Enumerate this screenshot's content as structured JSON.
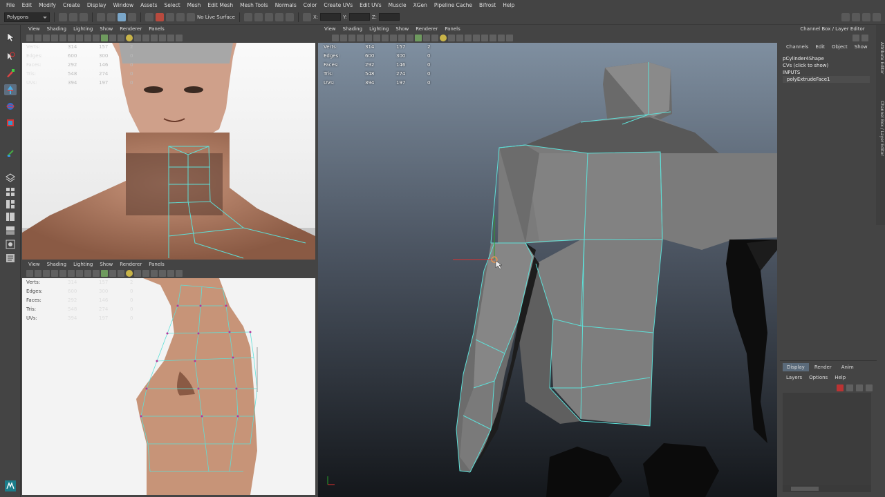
{
  "menubar": {
    "items": [
      "File",
      "Edit",
      "Modify",
      "Create",
      "Display",
      "Window",
      "Assets",
      "Select",
      "Mesh",
      "Edit Mesh",
      "Mesh Tools",
      "Normals",
      "Color",
      "Create UVs",
      "Edit UVs",
      "Muscle",
      "XGen",
      "Pipeline Cache",
      "Bifrost",
      "Help"
    ]
  },
  "shelf": {
    "mode": "Polygons",
    "live_surface": "No Live Surface",
    "x": "X:",
    "y": "Y:",
    "z": "Z:"
  },
  "panel_menus": [
    "View",
    "Shading",
    "Lighting",
    "Show",
    "Renderer",
    "Panels"
  ],
  "hud_labels": [
    "Verts:",
    "Edges:",
    "Faces:",
    "Tris:",
    "UVs:"
  ],
  "perspective_stats": [
    [
      "314",
      "157",
      "2"
    ],
    [
      "600",
      "300",
      "0"
    ],
    [
      "292",
      "146",
      "0"
    ],
    [
      "548",
      "274",
      "0"
    ],
    [
      "394",
      "197",
      "0"
    ]
  ],
  "front_stats": [
    [
      "314",
      "157",
      "2"
    ],
    [
      "600",
      "300",
      "0"
    ],
    [
      "292",
      "146",
      "0"
    ],
    [
      "548",
      "274",
      "0"
    ],
    [
      "394",
      "197",
      "0"
    ]
  ],
  "side_stats": [
    [
      "314",
      "157",
      "2"
    ],
    [
      "600",
      "300",
      "0"
    ],
    [
      "292",
      "146",
      "0"
    ],
    [
      "548",
      "274",
      "0"
    ],
    [
      "394",
      "197",
      "0"
    ]
  ],
  "channel_box": {
    "title": "Channel Box / Layer Editor",
    "menus": [
      "Channels",
      "Edit",
      "Object",
      "Show"
    ],
    "shape": "pCylinder4Shape",
    "cvs": "CVs (click to show)",
    "inputs": "INPUTS",
    "node": "polyExtrudeFace1"
  },
  "sidetabs": [
    "Attribute Editor",
    "Channel Box / Layer Editor"
  ],
  "layer_editor": {
    "tabs": [
      "Display",
      "Render",
      "Anim"
    ],
    "menus": [
      "Layers",
      "Options",
      "Help"
    ]
  },
  "colors": {
    "accent": "#5a6a7a",
    "wire": "#5ee0d8",
    "bg": "#444444"
  }
}
